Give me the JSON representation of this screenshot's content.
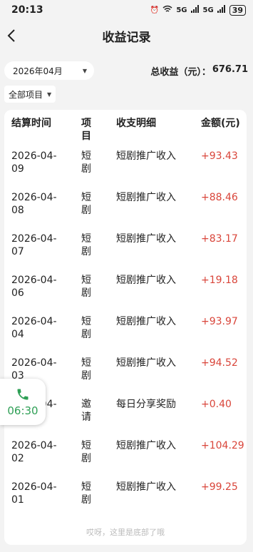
{
  "status_bar": {
    "time": "20:13",
    "network": "5G",
    "network2": "5G",
    "battery": "39"
  },
  "header": {
    "title": "收益记录"
  },
  "filters": {
    "month": "2026年04月",
    "project": "全部项目"
  },
  "summary": {
    "label": "总收益（元）：",
    "value": "676.71"
  },
  "table": {
    "headers": [
      "结算时间",
      "项目",
      "收支明细",
      "金额(元)"
    ],
    "rows": [
      {
        "date": "2026-04-09",
        "project": "短剧",
        "detail": "短剧推广收入",
        "amount": "+93.43"
      },
      {
        "date": "2026-04-08",
        "project": "短剧",
        "detail": "短剧推广收入",
        "amount": "+88.46"
      },
      {
        "date": "2026-04-07",
        "project": "短剧",
        "detail": "短剧推广收入",
        "amount": "+83.17"
      },
      {
        "date": "2026-04-06",
        "project": "短剧",
        "detail": "短剧推广收入",
        "amount": "+19.18"
      },
      {
        "date": "2026-04-04",
        "project": "短剧",
        "detail": "短剧推广收入",
        "amount": "+93.97"
      },
      {
        "date": "2026-04-03",
        "project": "短剧",
        "detail": "短剧推广收入",
        "amount": "+94.52"
      },
      {
        "date": "2026-04-02",
        "project": "邀请",
        "detail": "每日分享奖励",
        "amount": "+0.40"
      },
      {
        "date": "2026-04-02",
        "project": "短剧",
        "detail": "短剧推广收入",
        "amount": "+104.29"
      },
      {
        "date": "2026-04-01",
        "project": "短剧",
        "detail": "短剧推广收入",
        "amount": "+99.25"
      }
    ],
    "footer": "哎呀，这里是底部了哦"
  },
  "call_widget": {
    "time": "06:30"
  },
  "colors": {
    "amount": "#d9453a",
    "call": "#2e9f55"
  }
}
